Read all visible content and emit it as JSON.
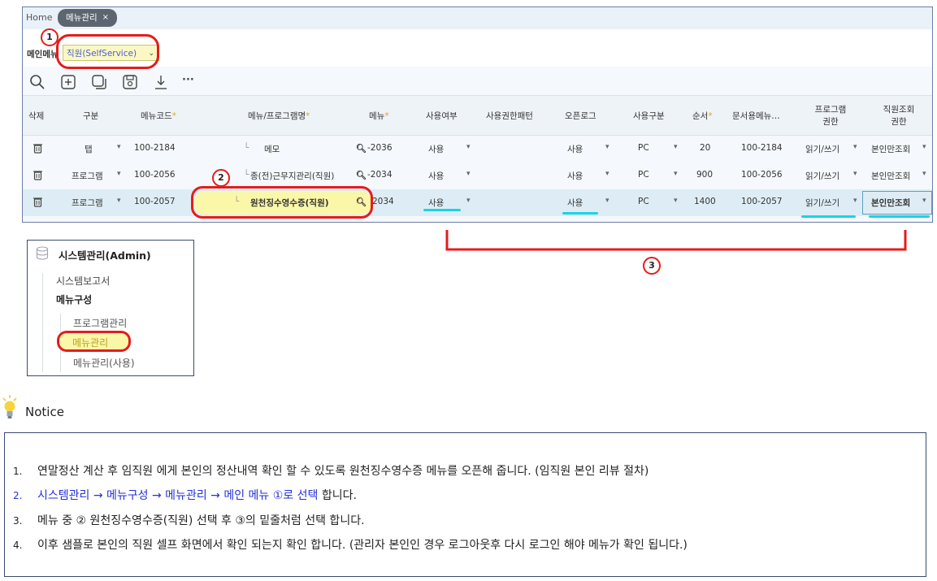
{
  "tabbar": {
    "home": "Home",
    "tab_label": "메뉴관리",
    "tab_close": "×"
  },
  "filter": {
    "label": "메인메뉴",
    "value": "직원(SelfService)"
  },
  "toolbar": {
    "icons": [
      "search-icon",
      "add-icon",
      "copy-icon",
      "save-icon",
      "download-icon",
      "more-icon"
    ],
    "more": "···"
  },
  "table": {
    "headers": [
      "삭제",
      "구분",
      "메뉴코드",
      "메뉴/프로그램명",
      "메뉴",
      "사용여부",
      "사용권한패턴",
      "오픈로그",
      "사용구분",
      "순서",
      "문서용메뉴…",
      "프로그램",
      "권한",
      "직원조회",
      "권한"
    ],
    "rows": [
      {
        "type": "탭",
        "code": "100-2184",
        "name": "메모",
        "menu": "-2036",
        "use": "사용",
        "openlog": "사용",
        "usage": "PC",
        "order": "20",
        "doc": "100-2184",
        "perm": "읽기/쓰기",
        "staff": "본인만조회"
      },
      {
        "type": "프로그램",
        "code": "100-2056",
        "name": "종(전)근무지관리(직원)",
        "menu": "-2034",
        "use": "사용",
        "openlog": "사용",
        "usage": "PC",
        "order": "900",
        "doc": "100-2056",
        "perm": "읽기/쓰기",
        "staff": "본인만조회"
      },
      {
        "type": "프로그램",
        "code": "100-2057",
        "name": "원천징수영수증(직원)",
        "menu": "2034",
        "use": "사용",
        "openlog": "사용",
        "usage": "PC",
        "order": "1400",
        "doc": "100-2057",
        "perm": "읽기/쓰기",
        "staff": "본인만조회"
      }
    ]
  },
  "callouts": {
    "one": "1",
    "two": "2",
    "three": "3"
  },
  "sidebar": {
    "title": "시스템관리(Admin)",
    "items": [
      "시스템보고서",
      "메뉴구성",
      "프로그램관리",
      "메뉴관리",
      "메뉴관리(사용)"
    ]
  },
  "notice": {
    "title": "Notice",
    "lines": [
      {
        "num": "1.",
        "text": "연말정산 계산 후 임직원 에게 본인의 정산내역 확인 할 수 있도록 원천징수영수증 메뉴를 오픈해 줍니다. (임직원 본인 리뷰 절차)"
      },
      {
        "num": "2.",
        "path": "시스템관리 → 메뉴구성 → 메뉴관리 → 메인 메뉴 ①로 선택",
        "tail": " 합니다."
      },
      {
        "num": "3.",
        "text": "메뉴 중 ② 원천징수영수증(직원) 선택 후 ③의 밑줄처럼 선택 합니다."
      },
      {
        "num": "4.",
        "text": "이후 샘플로 본인의 직원 셀프 화면에서 확인 되는지 확인 합니다. (관리자 본인인 경우 로그아웃후 다시 로그인 해야 메뉴가 확인 됩니다.)"
      }
    ]
  }
}
